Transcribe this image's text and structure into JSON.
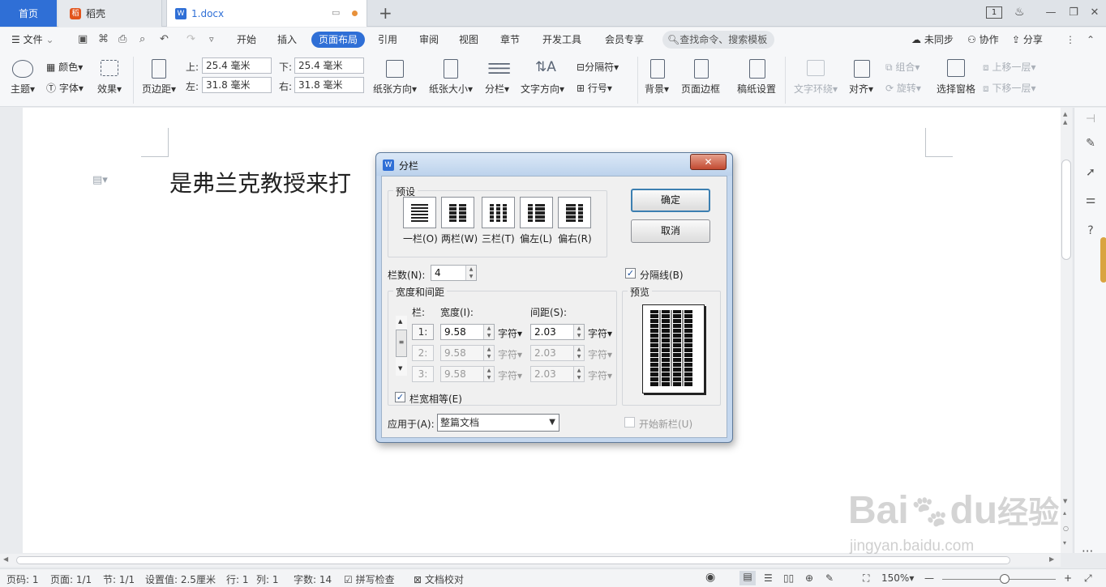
{
  "tabs": {
    "home": "首页",
    "docer": "稻壳",
    "doc": "1.docx",
    "new_tab": "+"
  },
  "window": {
    "page_badge": "1",
    "minimize": "—",
    "restore": "❐",
    "close": "✕"
  },
  "menu": {
    "file": "文件",
    "items": [
      "开始",
      "插入",
      "页面布局",
      "引用",
      "审阅",
      "视图",
      "章节",
      "开发工具",
      "会员专享"
    ],
    "active": "页面布局",
    "search": "查找命令、搜索模板",
    "sync": "未同步",
    "collab": "协作",
    "share": "分享"
  },
  "ribbon": {
    "theme": "主题",
    "colors": "颜色",
    "fonts": "字体",
    "effects": "效果",
    "margins": "页边距",
    "top_label": "上:",
    "top_value": "25.4 毫米",
    "bottom_label": "下:",
    "bottom_value": "25.4 毫米",
    "left_label": "左:",
    "left_value": "31.8 毫米",
    "right_label": "右:",
    "right_value": "31.8 毫米",
    "orientation": "纸张方向",
    "size": "纸张大小",
    "columns": "分栏",
    "text_direction": "文字方向",
    "separator": "分隔符",
    "line_numbers": "行号",
    "background": "背景",
    "page_border": "页面边框",
    "manuscript": "稿纸设置",
    "text_wrap": "文字环绕",
    "align": "对齐",
    "group": "组合",
    "rotate": "旋转",
    "selection_pane": "选择窗格",
    "bring_forward": "上移一层",
    "send_backward": "下移一层"
  },
  "document": {
    "text": "是弗兰克教授来打"
  },
  "dialog": {
    "title": "分栏",
    "presets_label": "预设",
    "presets": [
      "一栏(O)",
      "两栏(W)",
      "三栏(T)",
      "偏左(L)",
      "偏右(R)"
    ],
    "ok": "确定",
    "cancel": "取消",
    "num_cols_label": "栏数(N):",
    "num_cols": "4",
    "separator_label": "分隔线(B)",
    "width_spacing_label": "宽度和间距",
    "col_header": "栏:",
    "width_header": "宽度(I):",
    "spacing_header": "间距(S):",
    "rows": [
      {
        "num": "1:",
        "width": "9.58",
        "unit": "字符",
        "spacing": "2.03",
        "unit2": "字符"
      },
      {
        "num": "2:",
        "width": "9.58",
        "unit": "字符",
        "spacing": "2.03",
        "unit2": "字符"
      },
      {
        "num": "3:",
        "width": "9.58",
        "unit": "字符",
        "spacing": "2.03",
        "unit2": "字符"
      }
    ],
    "equal_width_label": "栏宽相等(E)",
    "preview_label": "预览",
    "apply_label": "应用于(A):",
    "apply_value": "整篇文档",
    "new_col_label": "开始新栏(U)"
  },
  "status": {
    "page_num": "页码: 1",
    "pages": "页面: 1/1",
    "section": "节: 1/1",
    "setting": "设置值: 2.5厘米",
    "row": "行: 1",
    "col": "列: 1",
    "words": "字数: 14",
    "spell": "拼写检查",
    "proof": "文档校对",
    "zoom": "150%"
  },
  "watermark": {
    "brand": "Bai",
    "brand2": "du",
    "brand3": "经验",
    "url": "jingyan.baidu.com"
  }
}
